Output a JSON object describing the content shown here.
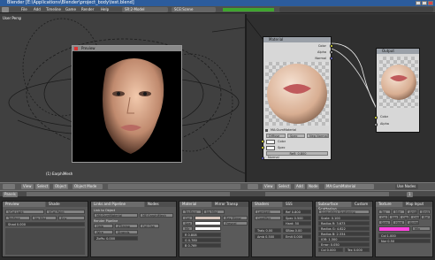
{
  "window": {
    "title": "Blender [E:\\Applications\\Blender\\project_body\\test.blend]"
  },
  "menubar": {
    "items": [
      "File",
      "Add",
      "Timeline",
      "Game",
      "Render",
      "Help"
    ],
    "screen": "SR:2-Model",
    "scene": "SCE:Scene"
  },
  "viewport": {
    "label": "User Persp",
    "render_panel_title": "Preview",
    "object_name": "(1) EarphiMesh",
    "toolbar": {
      "view": "View",
      "select": "Select",
      "object": "Object",
      "mode": "Object Mode"
    }
  },
  "node_editor": {
    "material_node": {
      "title": "Material",
      "outputs": [
        "Color",
        "Alpha",
        "Normal"
      ],
      "material_name": "MA:GumMaterial",
      "color_label": "Color",
      "spec_label": "Spec",
      "ref_label": "Refl: 0.800",
      "diffuse": "Diffuse",
      "spec_btn": "Spec",
      "neg_normal": "Neg Normal",
      "normal": "Normal"
    },
    "output_node": {
      "title": "Output",
      "inputs": [
        "Color",
        "Alpha"
      ]
    },
    "toolbar": {
      "view": "View",
      "select": "Select",
      "add": "Add",
      "node": "Node",
      "material": "MA:GumMaterial",
      "usenodes": "Use Nodes"
    }
  },
  "buttons_window": {
    "toolbar": {
      "panels": "Panels",
      "frame": "1"
    },
    "panels": [
      {
        "tab": "Preview",
        "tab2": "Shade",
        "lines": [
          "VCol Light",
          "VCol Paint",
          "TexFace",
          "No Mist",
          "Env",
          "Shad 0.000"
        ]
      },
      {
        "tab": "Links and Pipeline",
        "tab2": "Nodes",
        "lines": [
          "Link to Object",
          "MA:GumMaterial",
          "ME:EarphiMesh",
          "Render Pipeline",
          "Halo",
          "ZTransp",
          "Full Osa",
          "Wire",
          "Strands",
          "Zoffs: 0.000"
        ]
      },
      {
        "tab": "Material",
        "tab2": "Mirror Transp",
        "lines": [
          "TexFace",
          "No Mist",
          "Col",
          "Spe",
          "Mir",
          "R 0.808",
          "G 0.780",
          "B 0.769",
          "Ray Mirror",
          "Fresnel"
        ]
      },
      {
        "tab": "Shaders",
        "tab2": "SSS",
        "lines": [
          "Lambert",
          "Ref 0.800",
          "CookTorr",
          "Spec 0.500",
          "Hard: 50",
          "Tralu 0.00",
          "SBias 0.00",
          "Amb 0.500",
          "Emit 0.000"
        ]
      },
      {
        "tab": "Subsurface Scattering",
        "tab2": "Custom",
        "lines": [
          "Subsurface Scattering",
          "Scale: 0.100",
          "Radius R: 3.673",
          "Radius G: 4.822",
          "Radius B: 2.334",
          "IOR: 1.300",
          "Error: 0.050",
          "Col 0.000",
          "Tex 0.000"
        ]
      },
      {
        "tab": "Texture",
        "tab2": "Map Input",
        "lines": [
          "Tex",
          "Mirr",
          "Amb",
          "Emit",
          "Col",
          "Nor",
          "Csp",
          "Cmir",
          "Ref",
          "Spec",
          "Hard",
          "Alpha",
          "Mix",
          "Col 1.000",
          "Nor 0.50"
        ]
      }
    ]
  },
  "colors": {
    "accent_green": "#3fa52f",
    "accent_magenta": "#ff44dd",
    "accent_blue": "#2c5c9c"
  }
}
